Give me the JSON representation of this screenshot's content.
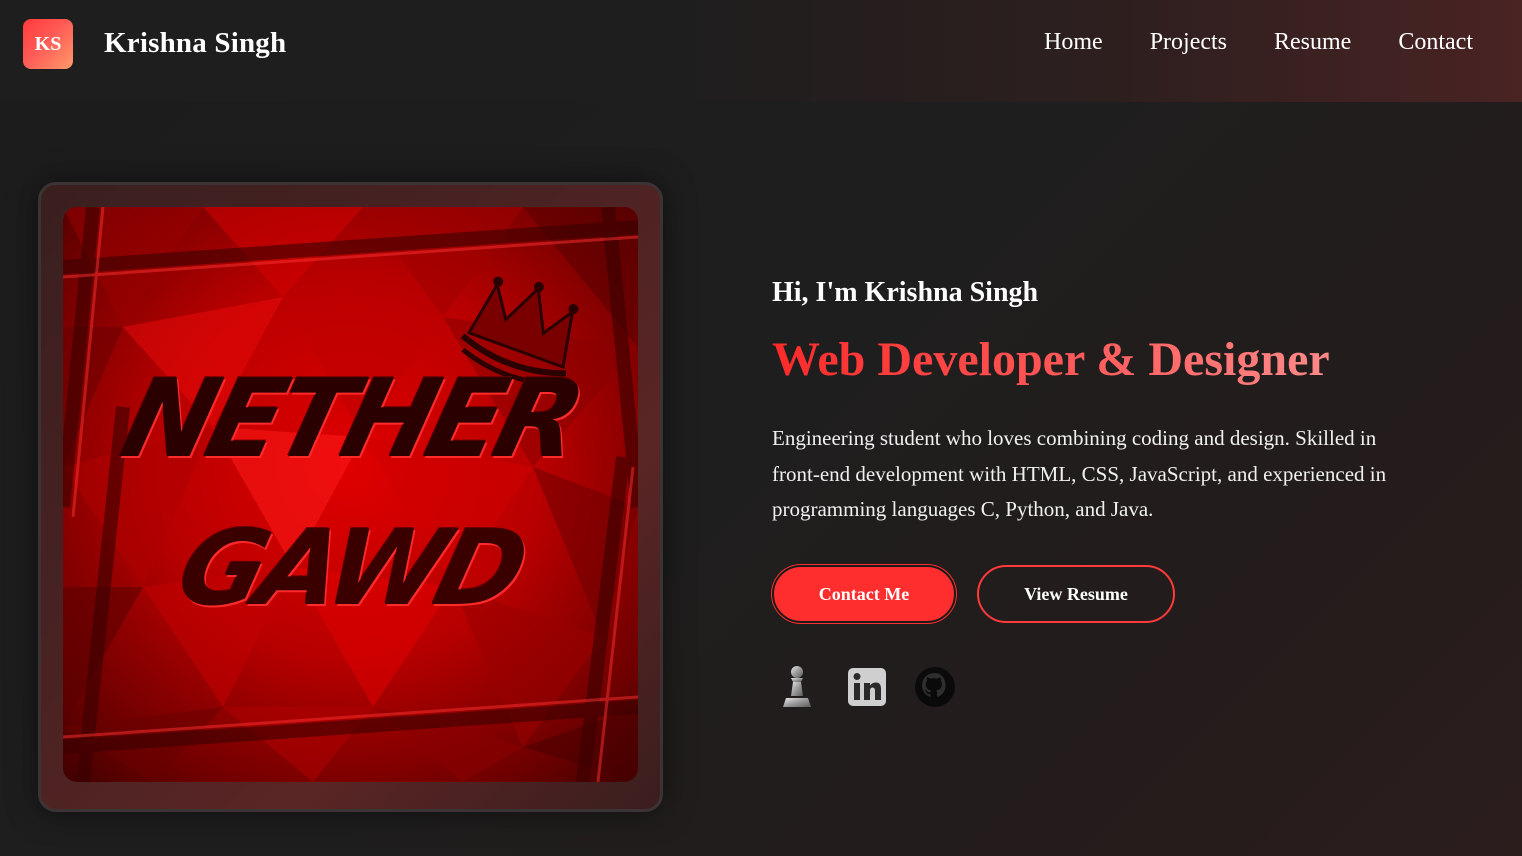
{
  "header": {
    "logo_initials": "KS",
    "brand_name": "Krishna Singh",
    "nav": [
      "Home",
      "Projects",
      "Resume",
      "Contact"
    ]
  },
  "hero": {
    "image_logo_text": [
      "NETHER",
      "GAWD"
    ],
    "greeting": "Hi, I'm Krishna Singh",
    "role": "Web Developer & Designer",
    "bio": "Engineering student who loves combining coding and design. Skilled in front-end development with HTML, CSS, JavaScript, and experienced in programming languages C, Python, and Java.",
    "buttons": {
      "contact": "Contact Me",
      "resume": "View Resume"
    },
    "social_icons": [
      "chess-pawn-icon",
      "linkedin-icon",
      "github-icon"
    ]
  },
  "colors": {
    "accent": "#ff2e2e",
    "background": "#1e1e1e",
    "header_gradient_end": "#4a2323"
  }
}
